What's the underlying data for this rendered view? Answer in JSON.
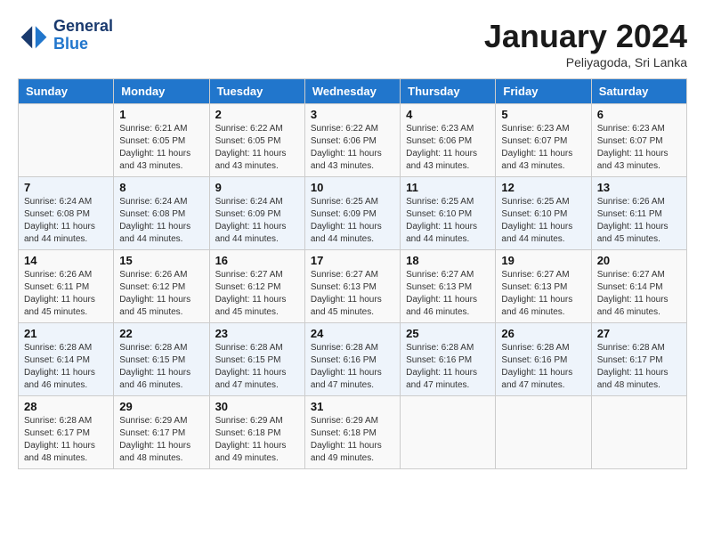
{
  "header": {
    "logo_line1": "General",
    "logo_line2": "Blue",
    "month": "January 2024",
    "location": "Peliyagoda, Sri Lanka"
  },
  "columns": [
    "Sunday",
    "Monday",
    "Tuesday",
    "Wednesday",
    "Thursday",
    "Friday",
    "Saturday"
  ],
  "weeks": [
    [
      {
        "day": "",
        "sunrise": "",
        "sunset": "",
        "daylight": ""
      },
      {
        "day": "1",
        "sunrise": "Sunrise: 6:21 AM",
        "sunset": "Sunset: 6:05 PM",
        "daylight": "Daylight: 11 hours and 43 minutes."
      },
      {
        "day": "2",
        "sunrise": "Sunrise: 6:22 AM",
        "sunset": "Sunset: 6:05 PM",
        "daylight": "Daylight: 11 hours and 43 minutes."
      },
      {
        "day": "3",
        "sunrise": "Sunrise: 6:22 AM",
        "sunset": "Sunset: 6:06 PM",
        "daylight": "Daylight: 11 hours and 43 minutes."
      },
      {
        "day": "4",
        "sunrise": "Sunrise: 6:23 AM",
        "sunset": "Sunset: 6:06 PM",
        "daylight": "Daylight: 11 hours and 43 minutes."
      },
      {
        "day": "5",
        "sunrise": "Sunrise: 6:23 AM",
        "sunset": "Sunset: 6:07 PM",
        "daylight": "Daylight: 11 hours and 43 minutes."
      },
      {
        "day": "6",
        "sunrise": "Sunrise: 6:23 AM",
        "sunset": "Sunset: 6:07 PM",
        "daylight": "Daylight: 11 hours and 43 minutes."
      }
    ],
    [
      {
        "day": "7",
        "sunrise": "Sunrise: 6:24 AM",
        "sunset": "Sunset: 6:08 PM",
        "daylight": "Daylight: 11 hours and 44 minutes."
      },
      {
        "day": "8",
        "sunrise": "Sunrise: 6:24 AM",
        "sunset": "Sunset: 6:08 PM",
        "daylight": "Daylight: 11 hours and 44 minutes."
      },
      {
        "day": "9",
        "sunrise": "Sunrise: 6:24 AM",
        "sunset": "Sunset: 6:09 PM",
        "daylight": "Daylight: 11 hours and 44 minutes."
      },
      {
        "day": "10",
        "sunrise": "Sunrise: 6:25 AM",
        "sunset": "Sunset: 6:09 PM",
        "daylight": "Daylight: 11 hours and 44 minutes."
      },
      {
        "day": "11",
        "sunrise": "Sunrise: 6:25 AM",
        "sunset": "Sunset: 6:10 PM",
        "daylight": "Daylight: 11 hours and 44 minutes."
      },
      {
        "day": "12",
        "sunrise": "Sunrise: 6:25 AM",
        "sunset": "Sunset: 6:10 PM",
        "daylight": "Daylight: 11 hours and 44 minutes."
      },
      {
        "day": "13",
        "sunrise": "Sunrise: 6:26 AM",
        "sunset": "Sunset: 6:11 PM",
        "daylight": "Daylight: 11 hours and 45 minutes."
      }
    ],
    [
      {
        "day": "14",
        "sunrise": "Sunrise: 6:26 AM",
        "sunset": "Sunset: 6:11 PM",
        "daylight": "Daylight: 11 hours and 45 minutes."
      },
      {
        "day": "15",
        "sunrise": "Sunrise: 6:26 AM",
        "sunset": "Sunset: 6:12 PM",
        "daylight": "Daylight: 11 hours and 45 minutes."
      },
      {
        "day": "16",
        "sunrise": "Sunrise: 6:27 AM",
        "sunset": "Sunset: 6:12 PM",
        "daylight": "Daylight: 11 hours and 45 minutes."
      },
      {
        "day": "17",
        "sunrise": "Sunrise: 6:27 AM",
        "sunset": "Sunset: 6:13 PM",
        "daylight": "Daylight: 11 hours and 45 minutes."
      },
      {
        "day": "18",
        "sunrise": "Sunrise: 6:27 AM",
        "sunset": "Sunset: 6:13 PM",
        "daylight": "Daylight: 11 hours and 46 minutes."
      },
      {
        "day": "19",
        "sunrise": "Sunrise: 6:27 AM",
        "sunset": "Sunset: 6:13 PM",
        "daylight": "Daylight: 11 hours and 46 minutes."
      },
      {
        "day": "20",
        "sunrise": "Sunrise: 6:27 AM",
        "sunset": "Sunset: 6:14 PM",
        "daylight": "Daylight: 11 hours and 46 minutes."
      }
    ],
    [
      {
        "day": "21",
        "sunrise": "Sunrise: 6:28 AM",
        "sunset": "Sunset: 6:14 PM",
        "daylight": "Daylight: 11 hours and 46 minutes."
      },
      {
        "day": "22",
        "sunrise": "Sunrise: 6:28 AM",
        "sunset": "Sunset: 6:15 PM",
        "daylight": "Daylight: 11 hours and 46 minutes."
      },
      {
        "day": "23",
        "sunrise": "Sunrise: 6:28 AM",
        "sunset": "Sunset: 6:15 PM",
        "daylight": "Daylight: 11 hours and 47 minutes."
      },
      {
        "day": "24",
        "sunrise": "Sunrise: 6:28 AM",
        "sunset": "Sunset: 6:16 PM",
        "daylight": "Daylight: 11 hours and 47 minutes."
      },
      {
        "day": "25",
        "sunrise": "Sunrise: 6:28 AM",
        "sunset": "Sunset: 6:16 PM",
        "daylight": "Daylight: 11 hours and 47 minutes."
      },
      {
        "day": "26",
        "sunrise": "Sunrise: 6:28 AM",
        "sunset": "Sunset: 6:16 PM",
        "daylight": "Daylight: 11 hours and 47 minutes."
      },
      {
        "day": "27",
        "sunrise": "Sunrise: 6:28 AM",
        "sunset": "Sunset: 6:17 PM",
        "daylight": "Daylight: 11 hours and 48 minutes."
      }
    ],
    [
      {
        "day": "28",
        "sunrise": "Sunrise: 6:28 AM",
        "sunset": "Sunset: 6:17 PM",
        "daylight": "Daylight: 11 hours and 48 minutes."
      },
      {
        "day": "29",
        "sunrise": "Sunrise: 6:29 AM",
        "sunset": "Sunset: 6:17 PM",
        "daylight": "Daylight: 11 hours and 48 minutes."
      },
      {
        "day": "30",
        "sunrise": "Sunrise: 6:29 AM",
        "sunset": "Sunset: 6:18 PM",
        "daylight": "Daylight: 11 hours and 49 minutes."
      },
      {
        "day": "31",
        "sunrise": "Sunrise: 6:29 AM",
        "sunset": "Sunset: 6:18 PM",
        "daylight": "Daylight: 11 hours and 49 minutes."
      },
      {
        "day": "",
        "sunrise": "",
        "sunset": "",
        "daylight": ""
      },
      {
        "day": "",
        "sunrise": "",
        "sunset": "",
        "daylight": ""
      },
      {
        "day": "",
        "sunrise": "",
        "sunset": "",
        "daylight": ""
      }
    ]
  ]
}
